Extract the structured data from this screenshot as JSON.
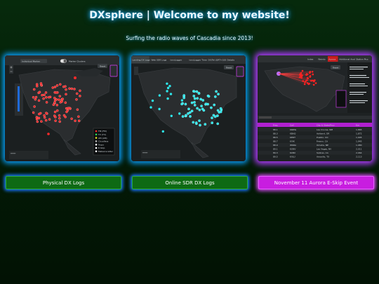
{
  "header": {
    "title": "DXsphere | Welcome to my website!",
    "subtitle": "Surfing the radio waves of Cascadia since 2013!"
  },
  "cards": [
    {
      "button_label": "Physical DX Logs",
      "thumbnail": {
        "toolbar_left": "Individual Marker",
        "toolbar_right": "Marker Clusters",
        "reset_label": "Reset",
        "legend": [
          "FM (FM)",
          "TV (TV)",
          "AM (AM)",
          "Cloudless",
          "Tropo",
          "E-Skip",
          "Meteorscatter"
        ],
        "accent": "#ff2a2a"
      }
    },
    {
      "button_label": "Online SDR DX Logs",
      "thumbnail": {
        "tabs": [
          "Landing DX Logs",
          "Web SDR Logs",
          "ionoLogger",
          "ionoLogger Time TV",
          "DX/Tel (QRT+1003)",
          "Details"
        ],
        "reset_label": "Reset",
        "accent": "#2ee6ea"
      }
    },
    {
      "button_label": "November 11 Aurora E-Skip Event",
      "thumbnail": {
        "tabs": [
          "Index",
          "Weirdo",
          "Aurora",
          "Additional Analysis",
          "Station Pics"
        ],
        "reset_label": "Reset",
        "table_headers": [
          "Freq",
          "Call",
          "City & State/Prov",
          "Km"
        ],
        "table_rows": [
          [
            "88.1",
            "KRWG",
            "Las Cruces, NM",
            "1,865"
          ],
          [
            "88.3",
            "KBAQ",
            "Ashland, OR",
            "1,872"
          ],
          [
            "88.5",
            "KEDT",
            "Pueblo, CO",
            "1,905"
          ],
          [
            "88.7",
            "KVIK",
            "Fresno, CA",
            "1,945"
          ],
          [
            "88.9",
            "WKRA",
            "Omaha, NE",
            "1,980"
          ],
          [
            "89.1",
            "KUNV",
            "Las Vegas, NV",
            "2,011"
          ],
          [
            "89.3",
            "KCBX",
            "Salinas, CA",
            "2,064"
          ],
          [
            "89.5",
            "KVLU",
            "Amarillo, TX",
            "2,113"
          ]
        ],
        "accent": "#ff2222",
        "header_color": "#b020d0"
      }
    }
  ]
}
